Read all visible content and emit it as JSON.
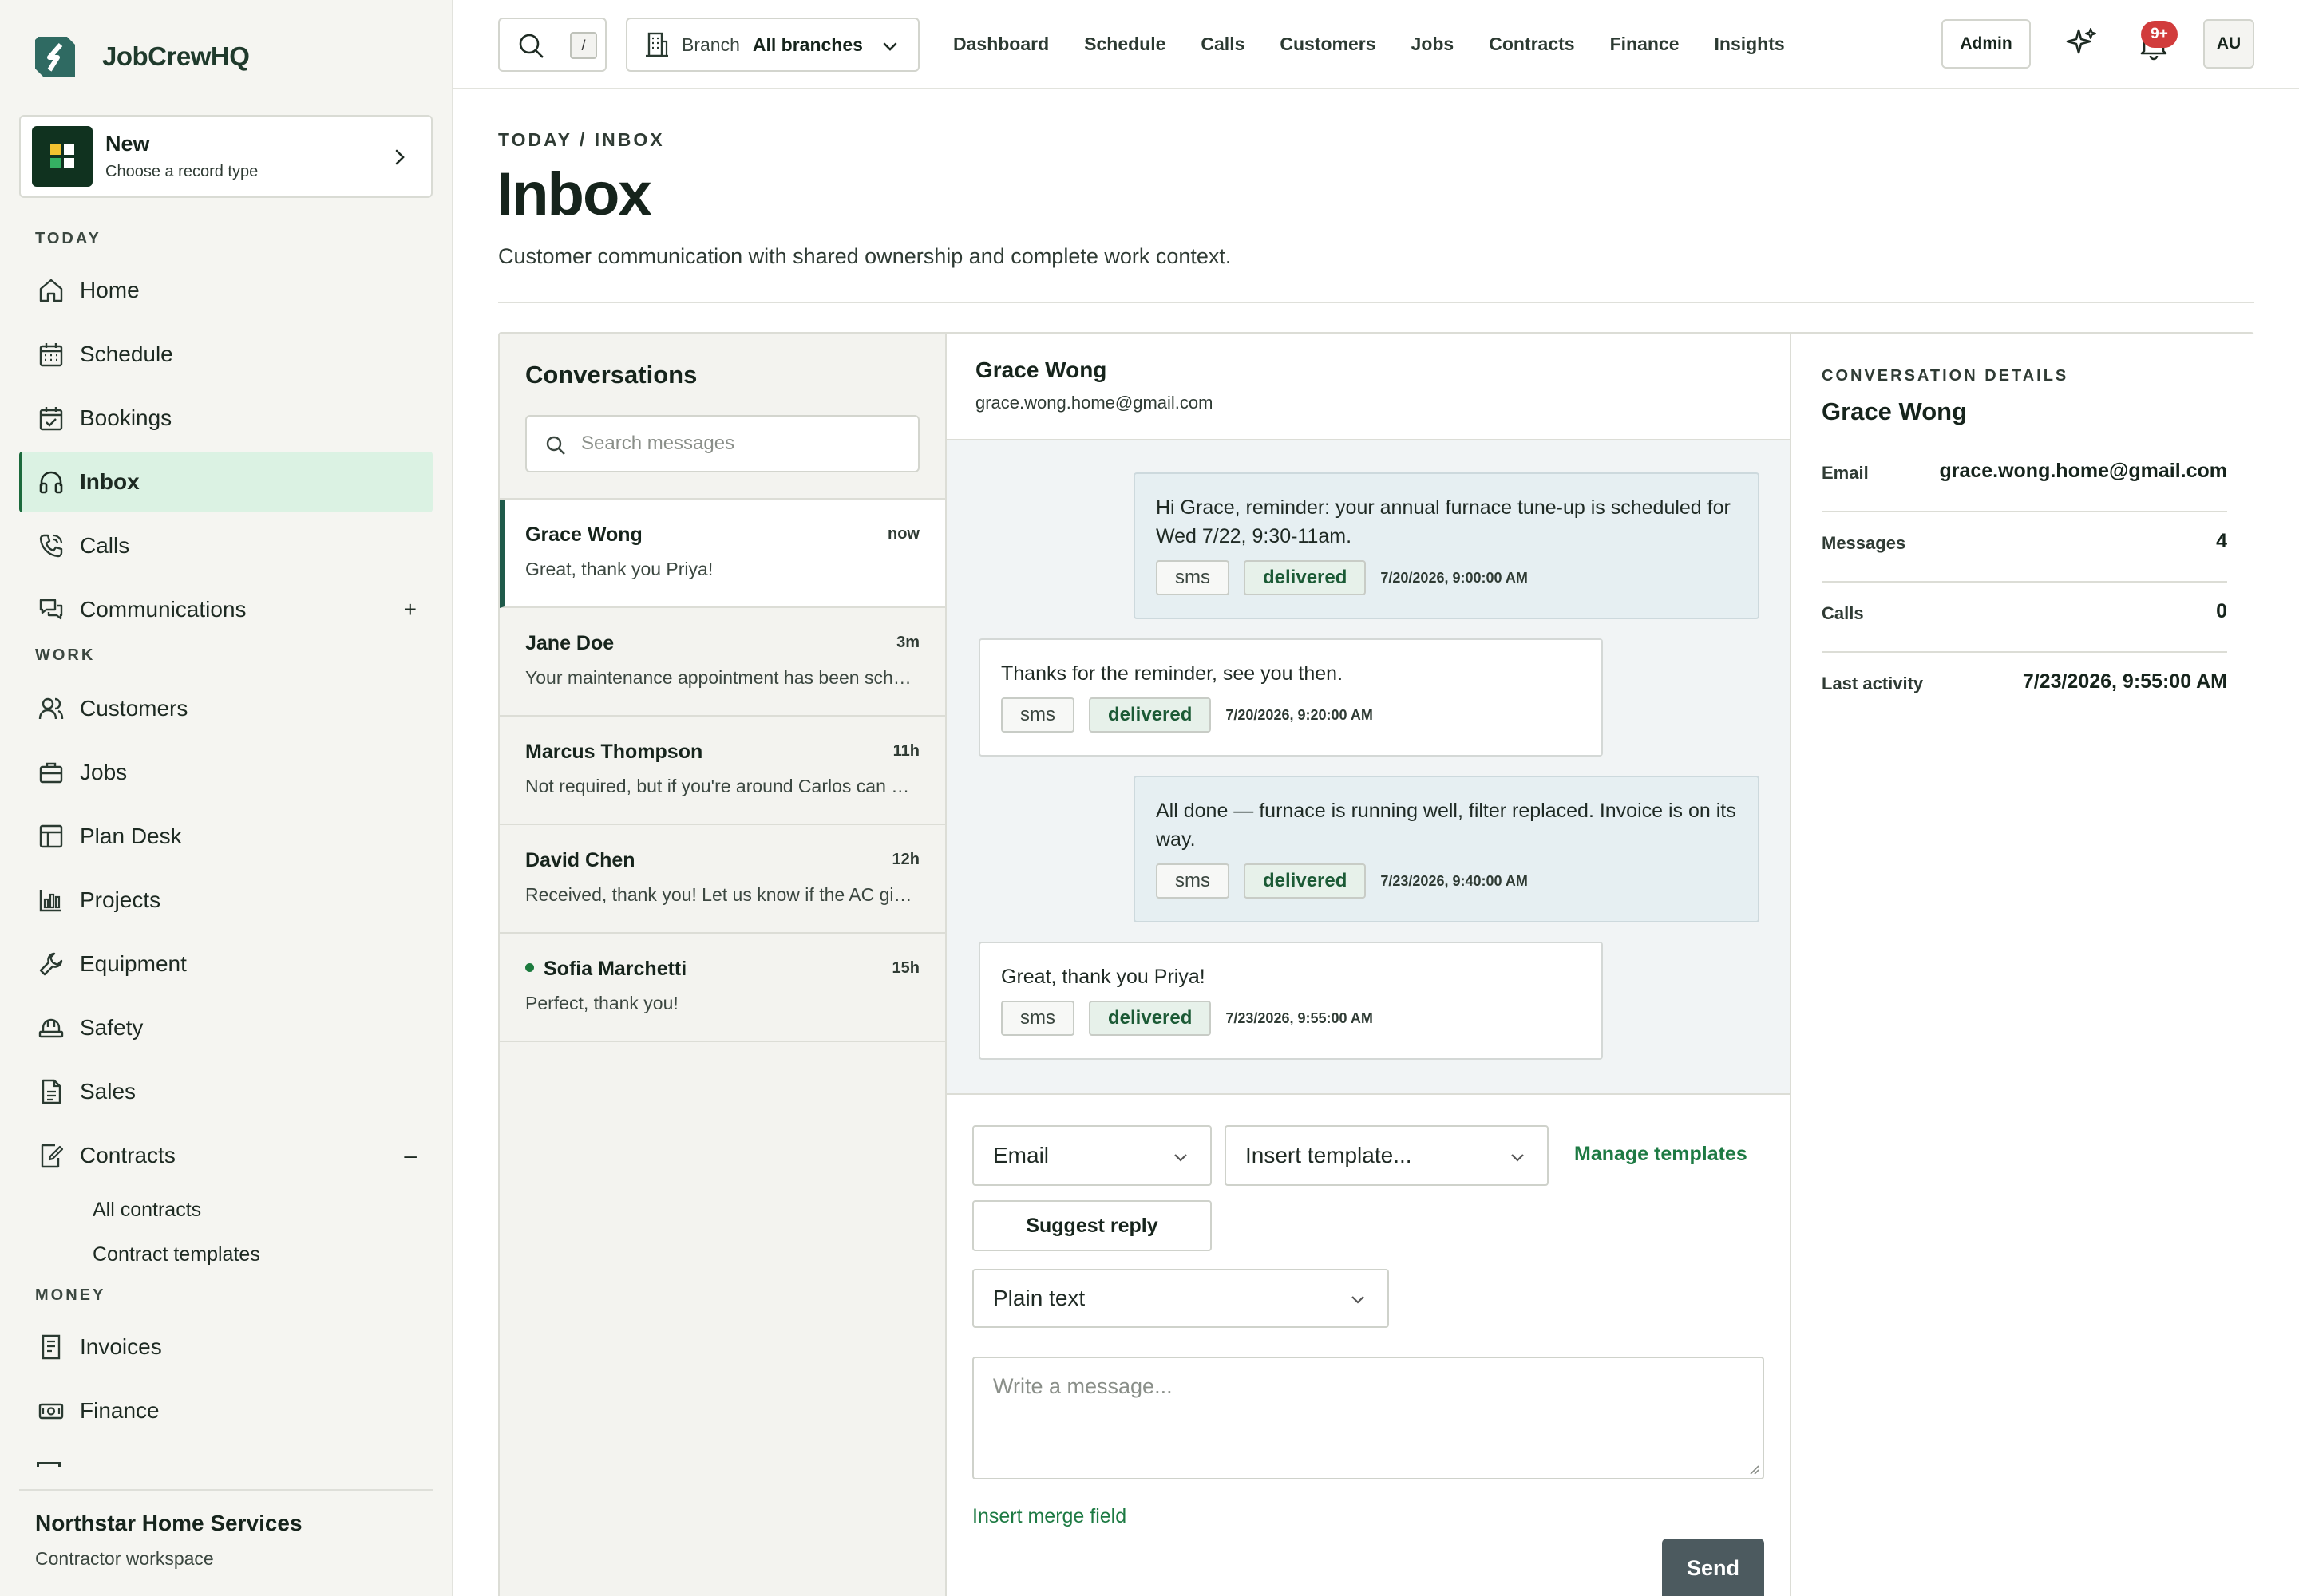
{
  "app": {
    "name": "JobCrewHQ"
  },
  "new_card": {
    "title": "New",
    "subtitle": "Choose a record type"
  },
  "sidebar": {
    "sections": {
      "today": "TODAY",
      "work": "WORK",
      "money": "MONEY"
    },
    "items": [
      {
        "label": "Home",
        "icon": "home-icon"
      },
      {
        "label": "Schedule",
        "icon": "calendar-icon"
      },
      {
        "label": "Bookings",
        "icon": "calendar-check-icon"
      },
      {
        "label": "Inbox",
        "icon": "headset-icon",
        "active": true
      },
      {
        "label": "Calls",
        "icon": "phone-icon"
      },
      {
        "label": "Communications",
        "icon": "chat-icon",
        "suffix": "+"
      },
      {
        "label": "Customers",
        "icon": "users-icon"
      },
      {
        "label": "Jobs",
        "icon": "briefcase-icon"
      },
      {
        "label": "Plan Desk",
        "icon": "layout-icon"
      },
      {
        "label": "Projects",
        "icon": "chart-icon"
      },
      {
        "label": "Equipment",
        "icon": "wrench-icon"
      },
      {
        "label": "Safety",
        "icon": "hardhat-icon"
      },
      {
        "label": "Sales",
        "icon": "document-icon"
      },
      {
        "label": "Contracts",
        "icon": "contract-edit-icon",
        "suffix": "–"
      },
      {
        "label": "Invoices",
        "icon": "invoice-icon"
      },
      {
        "label": "Finance",
        "icon": "money-icon"
      }
    ],
    "contract_subitems": [
      "All contracts",
      "Contract templates"
    ],
    "org_name": "Northstar Home Services",
    "org_sub": "Contractor workspace"
  },
  "topbar": {
    "search_shortcut": "/",
    "branch_label": "Branch",
    "branch_value": "All branches",
    "nav": [
      "Dashboard",
      "Schedule",
      "Calls",
      "Customers",
      "Jobs",
      "Contracts",
      "Finance",
      "Insights"
    ],
    "admin_label": "Admin",
    "notifications_badge": "9+",
    "avatar_initials": "AU"
  },
  "page": {
    "breadcrumb": "TODAY / INBOX",
    "title": "Inbox",
    "subtitle": "Customer communication with shared ownership and complete work context."
  },
  "conversations": {
    "title": "Conversations",
    "search_placeholder": "Search messages",
    "items": [
      {
        "name": "Grace Wong",
        "time": "now",
        "preview": "Great, thank you Priya!",
        "active": true,
        "unread": false
      },
      {
        "name": "Jane Doe",
        "time": "3m",
        "preview": "Your maintenance appointment has been scheduled for Thursday.",
        "active": false,
        "unread": false
      },
      {
        "name": "Marcus Thompson",
        "time": "11h",
        "preview": "Not required, but if you're around Carlos can walk you through it.",
        "active": false,
        "unread": false
      },
      {
        "name": "David Chen",
        "time": "12h",
        "preview": "Received, thank you! Let us know if the AC gives you any more trouble.",
        "active": false,
        "unread": false
      },
      {
        "name": "Sofia Marchetti",
        "time": "15h",
        "preview": "Perfect, thank you!",
        "active": false,
        "unread": true
      }
    ]
  },
  "thread": {
    "name": "Grace Wong",
    "email": "grace.wong.home@gmail.com",
    "messages": [
      {
        "direction": "out",
        "text": "Hi Grace, reminder: your annual furnace tune-up is scheduled for Wed 7/22, 9:30-11am.",
        "channel": "sms",
        "status": "delivered",
        "timestamp": "7/20/2026, 9:00:00 AM"
      },
      {
        "direction": "in",
        "text": "Thanks for the reminder, see you then.",
        "channel": "sms",
        "status": "delivered",
        "timestamp": "7/20/2026, 9:20:00 AM"
      },
      {
        "direction": "out",
        "text": "All done — furnace is running well, filter replaced. Invoice is on its way.",
        "channel": "sms",
        "status": "delivered",
        "timestamp": "7/23/2026, 9:40:00 AM"
      },
      {
        "direction": "in",
        "text": "Great, thank you Priya!",
        "channel": "sms",
        "status": "delivered",
        "timestamp": "7/23/2026, 9:55:00 AM"
      }
    ]
  },
  "composer": {
    "channel": "Email",
    "template_placeholder": "Insert template...",
    "manage_templates": "Manage templates",
    "suggest_reply": "Suggest reply",
    "format": "Plain text",
    "message_placeholder": "Write a message...",
    "insert_merge_field": "Insert merge field",
    "send": "Send"
  },
  "details": {
    "label": "CONVERSATION DETAILS",
    "name": "Grace Wong",
    "rows": [
      {
        "key": "Email",
        "value": "grace.wong.home@gmail.com"
      },
      {
        "key": "Messages",
        "value": "4"
      },
      {
        "key": "Calls",
        "value": "0"
      },
      {
        "key": "Last activity",
        "value": "7/23/2026, 9:55:00 AM"
      }
    ]
  },
  "colors": {
    "accent": "#1d7a43",
    "active_nav_bg": "#dbf2e3",
    "badge": "#d13c3c",
    "send_button": "#4c5a5f"
  }
}
